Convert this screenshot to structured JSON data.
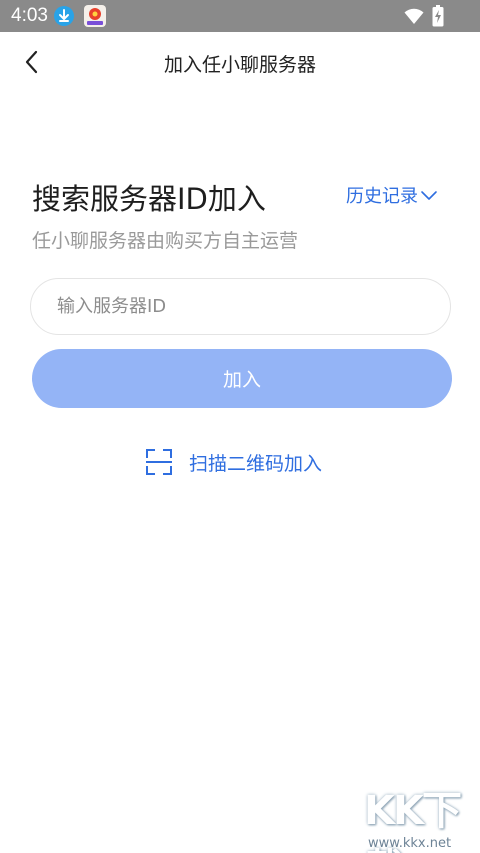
{
  "status_bar": {
    "time": "4:03",
    "icons": [
      "download-icon",
      "app-notification-icon",
      "wifi-icon",
      "battery-charging-icon"
    ]
  },
  "nav": {
    "title": "加入任小聊服务器",
    "back_icon": "chevron-left-icon"
  },
  "main": {
    "heading": "搜索服务器ID加入",
    "history_label": "历史记录",
    "subheading": "任小聊服务器由购买方自主运营",
    "id_input": {
      "value": "",
      "placeholder": "输入服务器ID"
    },
    "join_button_label": "加入",
    "scan_label": "扫描二维码加入",
    "scan_icon": "scan-frame-icon"
  },
  "watermark": {
    "main": "KK下载",
    "sub": "www.kkx.net"
  },
  "colors": {
    "status_bar_bg": "#8a8a8a",
    "accent": "#2f6ee0",
    "button_disabled": "#94b4f6",
    "muted_text": "#9a9a9a"
  }
}
